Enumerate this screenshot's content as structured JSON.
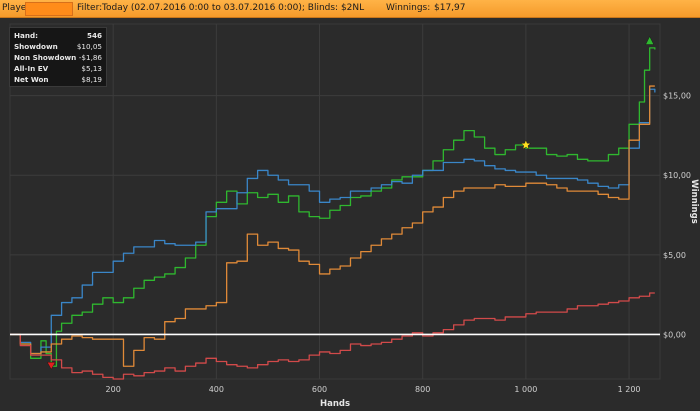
{
  "topbar": {
    "player_label": "Player:",
    "player_value": "",
    "filter_label": "Filter:",
    "filter_value": "Today (02.07.2016 0:00 to 03.07.2016 0:00); Blinds: $2NL",
    "winnings_label": "Winnings:",
    "winnings_value": "$17,97"
  },
  "stats": [
    {
      "label": "Hand:",
      "value": "546"
    },
    {
      "label": "Showdown",
      "value": "$10,05"
    },
    {
      "label": "Non Showdown",
      "value": "-$1,86"
    },
    {
      "label": "All-In EV",
      "value": "$5,13"
    },
    {
      "label": "Net Won",
      "value": "$8,19"
    }
  ],
  "chart_data": {
    "type": "line",
    "xlabel": "Hands",
    "ylabel": "Winnings",
    "xlim": [
      0,
      1260
    ],
    "ylim": [
      -2.8,
      19.5
    ],
    "x_ticks": [
      200,
      400,
      600,
      800,
      1000,
      1200
    ],
    "x_tick_labels": [
      "200",
      "400",
      "600",
      "800",
      "1 000",
      "1 200"
    ],
    "y_ticks": [
      0,
      5,
      10,
      15
    ],
    "y_tick_labels": [
      "$0,00",
      "$5,00",
      "$10,00",
      "$15,00"
    ],
    "grid": true,
    "series": [
      {
        "color": "#2fb82f",
        "x": [
          0,
          20,
          40,
          60,
          70,
          80,
          90,
          100,
          120,
          140,
          160,
          180,
          200,
          220,
          240,
          260,
          280,
          300,
          320,
          340,
          360,
          380,
          400,
          420,
          440,
          460,
          480,
          500,
          520,
          540,
          560,
          580,
          600,
          620,
          640,
          660,
          680,
          700,
          720,
          740,
          760,
          780,
          800,
          820,
          840,
          860,
          880,
          900,
          920,
          940,
          960,
          980,
          1000,
          1020,
          1040,
          1060,
          1080,
          1100,
          1120,
          1140,
          1160,
          1180,
          1200,
          1220,
          1230,
          1240,
          1250
        ],
        "y": [
          0,
          -0.6,
          -1.5,
          -0.4,
          -1.2,
          -2.0,
          0.2,
          0.7,
          1.2,
          1.4,
          1.9,
          2.3,
          2.0,
          2.3,
          2.9,
          3.4,
          3.6,
          3.8,
          4.2,
          4.8,
          5.6,
          7.4,
          8.3,
          9.0,
          8.2,
          8.9,
          8.6,
          8.8,
          8.3,
          8.7,
          7.7,
          7.4,
          7.3,
          7.8,
          8.1,
          8.6,
          8.7,
          9.0,
          9.2,
          9.7,
          9.9,
          9.9,
          10.3,
          10.9,
          11.6,
          12.2,
          12.8,
          12.4,
          11.7,
          11.3,
          11.6,
          11.9,
          11.7,
          11.7,
          11.3,
          11.2,
          11.3,
          11.0,
          10.9,
          10.9,
          11.3,
          11.7,
          13.2,
          14.6,
          16.6,
          18.0,
          17.9
        ]
      },
      {
        "color": "#3a86c8",
        "x": [
          0,
          20,
          40,
          60,
          80,
          100,
          120,
          140,
          160,
          180,
          200,
          220,
          240,
          260,
          280,
          300,
          320,
          340,
          360,
          380,
          400,
          420,
          440,
          460,
          480,
          500,
          520,
          540,
          560,
          580,
          600,
          620,
          640,
          660,
          680,
          700,
          720,
          740,
          760,
          780,
          800,
          820,
          840,
          860,
          880,
          900,
          920,
          940,
          960,
          980,
          1000,
          1020,
          1040,
          1060,
          1080,
          1100,
          1120,
          1140,
          1160,
          1180,
          1200,
          1220,
          1240,
          1250
        ],
        "y": [
          0,
          -0.5,
          -1.2,
          -0.8,
          1.2,
          2.0,
          2.3,
          3.1,
          3.9,
          3.9,
          4.6,
          5.1,
          5.5,
          5.5,
          5.9,
          5.7,
          5.6,
          5.6,
          5.8,
          7.7,
          7.9,
          7.9,
          8.9,
          9.8,
          10.3,
          10.0,
          9.7,
          9.4,
          9.4,
          9.0,
          8.3,
          8.5,
          8.6,
          9.0,
          9.0,
          9.2,
          9.4,
          9.6,
          9.5,
          10.0,
          10.3,
          10.3,
          10.8,
          10.8,
          11.0,
          10.9,
          10.6,
          10.4,
          10.3,
          10.2,
          10.2,
          10.0,
          9.8,
          9.8,
          9.8,
          9.7,
          9.5,
          9.3,
          9.2,
          9.4,
          11.7,
          13.3,
          15.4,
          15.2
        ]
      },
      {
        "color": "#e08a38",
        "x": [
          0,
          20,
          40,
          60,
          80,
          100,
          120,
          140,
          160,
          180,
          200,
          220,
          240,
          260,
          280,
          300,
          320,
          340,
          360,
          380,
          400,
          420,
          440,
          460,
          480,
          500,
          520,
          540,
          560,
          580,
          600,
          620,
          640,
          660,
          680,
          700,
          720,
          740,
          760,
          780,
          800,
          820,
          840,
          860,
          880,
          900,
          920,
          940,
          960,
          980,
          1000,
          1020,
          1040,
          1060,
          1080,
          1100,
          1120,
          1140,
          1160,
          1180,
          1200,
          1220,
          1240,
          1250
        ],
        "y": [
          0,
          -0.6,
          -1.2,
          -1.1,
          -0.6,
          -0.3,
          -0.1,
          -0.2,
          -0.3,
          -0.3,
          -0.3,
          -2.0,
          -1.0,
          -0.2,
          -0.3,
          0.8,
          1.0,
          1.6,
          1.6,
          1.8,
          2.0,
          4.5,
          4.6,
          6.3,
          5.6,
          5.8,
          5.4,
          5.3,
          4.6,
          4.4,
          3.8,
          4.1,
          4.3,
          4.8,
          5.2,
          5.6,
          6.0,
          6.3,
          6.7,
          7.0,
          7.7,
          8.0,
          8.6,
          9.0,
          9.2,
          9.2,
          9.2,
          9.4,
          9.3,
          9.3,
          9.5,
          9.5,
          9.4,
          9.2,
          9.0,
          9.0,
          9.0,
          8.8,
          8.6,
          8.5,
          12.2,
          13.2,
          15.6,
          15.6
        ]
      },
      {
        "color": "#d24a4a",
        "x": [
          0,
          20,
          40,
          60,
          80,
          100,
          120,
          140,
          160,
          180,
          200,
          220,
          240,
          260,
          280,
          300,
          320,
          340,
          360,
          380,
          400,
          420,
          440,
          460,
          480,
          500,
          520,
          540,
          560,
          580,
          600,
          620,
          640,
          660,
          680,
          700,
          720,
          740,
          760,
          780,
          800,
          820,
          840,
          860,
          880,
          900,
          920,
          940,
          960,
          980,
          1000,
          1020,
          1040,
          1060,
          1080,
          1100,
          1120,
          1140,
          1160,
          1180,
          1200,
          1220,
          1240,
          1250
        ],
        "y": [
          0,
          -0.7,
          -1.3,
          -1.3,
          -1.6,
          -2.1,
          -2.4,
          -2.3,
          -2.5,
          -2.7,
          -2.8,
          -2.5,
          -2.6,
          -2.4,
          -2.3,
          -2.1,
          -2.3,
          -2.0,
          -1.8,
          -1.5,
          -1.7,
          -1.9,
          -2.0,
          -2.1,
          -1.9,
          -1.7,
          -1.6,
          -1.7,
          -1.6,
          -1.3,
          -1.1,
          -1.2,
          -1.0,
          -0.6,
          -0.7,
          -0.6,
          -0.5,
          -0.3,
          -0.1,
          0.1,
          -0.1,
          0.1,
          0.3,
          0.6,
          0.9,
          1.0,
          1.0,
          0.9,
          1.1,
          1.1,
          1.3,
          1.4,
          1.4,
          1.4,
          1.6,
          1.8,
          1.8,
          1.9,
          2.0,
          2.1,
          2.3,
          2.4,
          2.6,
          2.6
        ]
      },
      {
        "color": "#ffffff",
        "x": [
          0,
          1260
        ],
        "y": [
          0,
          0
        ]
      }
    ],
    "markers": [
      {
        "shape": "triangle-down",
        "color": "#e02020",
        "x": 80,
        "y": -2.0
      },
      {
        "shape": "star",
        "color": "#ffe020",
        "x": 1000,
        "y": 11.9
      },
      {
        "shape": "triangle-up",
        "color": "#2fb82f",
        "x": 1240,
        "y": 18.4
      }
    ]
  }
}
